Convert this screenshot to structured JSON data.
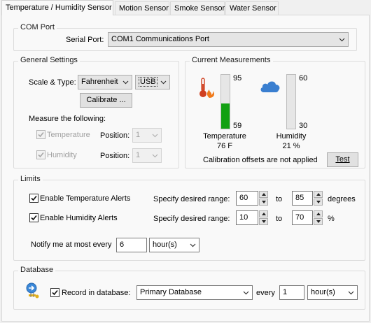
{
  "tabs": [
    {
      "label": "Temperature / Humidity Sensor",
      "active": true
    },
    {
      "label": "Motion Sensor",
      "active": false
    },
    {
      "label": "Smoke Sensor",
      "active": false
    },
    {
      "label": "Water Sensor",
      "active": false
    }
  ],
  "com_port": {
    "title": "COM Port",
    "serial_port_label": "Serial Port:",
    "serial_port_value": "COM1 Communications Port"
  },
  "general": {
    "title": "General Settings",
    "scale_type_label": "Scale & Type:",
    "scale_value": "Fahrenheit",
    "type_value": "USB",
    "calibrate_label": "Calibrate ...",
    "measure_label": "Measure the following:",
    "temperature_label": "Temperature",
    "humidity_label": "Humidity",
    "position_label": "Position:",
    "temperature_position": "1",
    "humidity_position": "1"
  },
  "current": {
    "title": "Current Measurements",
    "temp_max": "95",
    "temp_min": "59",
    "temp_fill_fraction": 0.47,
    "temp_label": "Temperature",
    "temp_value": "76 F",
    "hum_max": "60",
    "hum_min": "30",
    "hum_fill_fraction": 0.0,
    "hum_label": "Humidity",
    "hum_value": "21 %",
    "calibration_note": "Calibration offsets are not applied",
    "test_label": "Test",
    "temp_fill_color": "#12a012",
    "thermometer_color": "#e0431c",
    "cloud_color": "#3a7fd0"
  },
  "limits": {
    "title": "Limits",
    "enable_temp_label": "Enable Temperature Alerts",
    "enable_hum_label": "Enable Humidity Alerts",
    "range_label_1": "Specify desired range:",
    "range_label_2": "Specify desired range:",
    "temp_low": "60",
    "temp_high": "85",
    "temp_to": "to",
    "temp_unit": "degrees",
    "hum_low": "10",
    "hum_high": "70",
    "hum_to": "to",
    "hum_unit": "%",
    "notify_label": "Notify me at most every",
    "notify_value": "6",
    "notify_unit": "hour(s)"
  },
  "database": {
    "title": "Database",
    "record_label": "Record in database:",
    "db_value": "Primary Database",
    "every_label": "every",
    "every_value": "1",
    "every_unit": "hour(s)"
  }
}
